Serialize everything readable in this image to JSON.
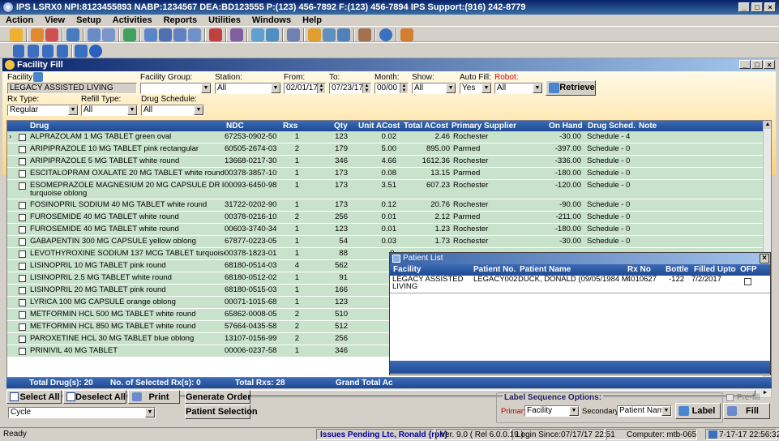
{
  "app": {
    "title": "IPS  LSRX0  NPI:8123455893  NABP:1234567  DEA:BD123555  P:(123) 456-7892  F:(123) 456-7894       IPS Support:(916) 242-8779"
  },
  "menu": [
    "Action",
    "View",
    "Setup",
    "Activities",
    "Reports",
    "Utilities",
    "Windows",
    "Help"
  ],
  "window": {
    "title": "Facility Fill"
  },
  "filters": {
    "facility_label": "Facility",
    "facility_value": "LEGACY ASSISTED LIVING",
    "facility_group_label": "Facility Group:",
    "facility_group_value": "",
    "station_label": "Station:",
    "station_value": "All",
    "from_label": "From:",
    "from_value": "02/01/17",
    "to_label": "To:",
    "to_value": "07/23/17",
    "month_label": "Month:",
    "month_value": "00/00",
    "show_label": "Show:",
    "show_value": "All",
    "autofill_label": "Auto Fill:",
    "autofill_value": "Yes",
    "robot_label": "Robot:",
    "robot_value": "All",
    "retrieve_label": "Retrieve",
    "rxtype_label": "Rx Type:",
    "rxtype_value": "Regular",
    "refilltype_label": "Refill Type:",
    "refilltype_value": "All",
    "drugschedule_label": "Drug Schedule:",
    "drugschedule_value": "All"
  },
  "grid": {
    "columns": [
      "Drug",
      "NDC",
      "Rxs",
      "Qty",
      "Unit ACost",
      "Total ACost",
      "Primary Supplier",
      "On Hand",
      "Drug Sched.",
      "Note"
    ],
    "rows": [
      {
        "drug": "ALPRAZOLAM 1 MG TABLET green oval",
        "ndc": "67253-0902-50",
        "rxs": "1",
        "qty": "123",
        "unit": "0.02",
        "total": "2.46",
        "supplier": "Rochester",
        "onhand": "-30.00",
        "sched": "Schedule - 4"
      },
      {
        "drug": "ARIPIPRAZOLE 10 MG TABLET pink rectangular",
        "ndc": "60505-2674-03",
        "rxs": "2",
        "qty": "179",
        "unit": "5.00",
        "total": "895.00",
        "supplier": "Parmed",
        "onhand": "-397.00",
        "sched": "Schedule - 0"
      },
      {
        "drug": "ARIPIPRAZOLE 5 MG TABLET white round",
        "ndc": "13668-0217-30",
        "rxs": "1",
        "qty": "346",
        "unit": "4.66",
        "total": "1612.36",
        "supplier": "Rochester",
        "onhand": "-336.00",
        "sched": "Schedule - 0"
      },
      {
        "drug": "ESCITALOPRAM OXALATE 20 MG TABLET white round",
        "ndc": "00378-3857-10",
        "rxs": "1",
        "qty": "173",
        "unit": "0.08",
        "total": "13.15",
        "supplier": "Parmed",
        "onhand": "-180.00",
        "sched": "Schedule - 0"
      },
      {
        "drug": "ESOMEPRAZOLE MAGNESIUM 20 MG CAPSULE DR light",
        "drug2": "turquoise oblong",
        "ndc": "00093-6450-98",
        "rxs": "1",
        "qty": "173",
        "unit": "3.51",
        "total": "607.23",
        "supplier": "Rochester",
        "onhand": "-120.00",
        "sched": "Schedule - 0"
      },
      {
        "drug": "FOSINOPRIL SODIUM 40 MG TABLET white round",
        "ndc": "31722-0202-90",
        "rxs": "1",
        "qty": "173",
        "unit": "0.12",
        "total": "20.76",
        "supplier": "Rochester",
        "onhand": "-90.00",
        "sched": "Schedule - 0"
      },
      {
        "drug": "FUROSEMIDE 40 MG TABLET white round",
        "ndc": "00378-0216-10",
        "rxs": "2",
        "qty": "256",
        "unit": "0.01",
        "total": "2.12",
        "supplier": "Parmed",
        "onhand": "-211.00",
        "sched": "Schedule - 0"
      },
      {
        "drug": "FUROSEMIDE 40 MG TABLET white round",
        "ndc": "00603-3740-34",
        "rxs": "1",
        "qty": "123",
        "unit": "0.01",
        "total": "1.23",
        "supplier": "Rochester",
        "onhand": "-180.00",
        "sched": "Schedule - 0"
      },
      {
        "drug": "GABAPENTIN 300 MG CAPSULE yellow oblong",
        "ndc": "67877-0223-05",
        "rxs": "1",
        "qty": "54",
        "unit": "0.03",
        "total": "1.73",
        "supplier": "Rochester",
        "onhand": "-30.00",
        "sched": "Schedule - 0"
      },
      {
        "drug": "LEVOTHYROXINE SODIUM 137 MCG TABLET turquoise oblong",
        "ndc": "00378-1823-01",
        "rxs": "1",
        "qty": "88",
        "unit": "0.",
        "total": "",
        "supplier": "",
        "onhand": "",
        "sched": ""
      },
      {
        "drug": "LISINOPRIL 10 MG TABLET pink round",
        "ndc": "68180-0514-03",
        "rxs": "4",
        "qty": "562",
        "unit": "0.",
        "total": "",
        "supplier": "",
        "onhand": "",
        "sched": ""
      },
      {
        "drug": "LISINOPRIL 2.5 MG TABLET white round",
        "ndc": "68180-0512-02",
        "rxs": "1",
        "qty": "91",
        "unit": "0.",
        "total": "",
        "supplier": "",
        "onhand": "",
        "sched": ""
      },
      {
        "drug": "LISINOPRIL 20 MG TABLET pink round",
        "ndc": "68180-0515-03",
        "rxs": "1",
        "qty": "166",
        "unit": "0.",
        "total": "",
        "supplier": "",
        "onhand": "",
        "sched": ""
      },
      {
        "drug": "LYRICA 100 MG CAPSULE orange oblong",
        "ndc": "00071-1015-68",
        "rxs": "1",
        "qty": "123",
        "unit": "5.",
        "total": "",
        "supplier": "",
        "onhand": "",
        "sched": ""
      },
      {
        "drug": "METFORMIN HCL 500 MG TABLET white round",
        "ndc": "65862-0008-05",
        "rxs": "2",
        "qty": "510",
        "unit": "0.",
        "total": "",
        "supplier": "",
        "onhand": "",
        "sched": ""
      },
      {
        "drug": "METFORMIN HCL 850 MG TABLET white round",
        "ndc": "57664-0435-58",
        "rxs": "2",
        "qty": "512",
        "unit": "0.",
        "total": "",
        "supplier": "",
        "onhand": "",
        "sched": ""
      },
      {
        "drug": "PAROXETINE HCL 30 MG TABLET blue oblong",
        "ndc": "13107-0156-99",
        "rxs": "2",
        "qty": "256",
        "unit": "0.",
        "total": "",
        "supplier": "",
        "onhand": "",
        "sched": ""
      },
      {
        "drug": "PRINIVIL 40 MG TABLET",
        "ndc": "00006-0237-58",
        "rxs": "1",
        "qty": "346",
        "unit": "1.",
        "total": "",
        "supplier": "",
        "onhand": "",
        "sched": ""
      }
    ],
    "footer": {
      "total_drugs": "Total Drug(s): 20",
      "selected_rxs": "No. of Selected Rx(s): 0",
      "total_rxs": "Total Rxs: 28",
      "grand_total": "Grand Total Ac"
    }
  },
  "patient_list": {
    "title": "Patient List",
    "columns": [
      "Facility",
      "Patient No.",
      "Patient Name",
      "Rx No",
      "Bottle",
      "Filled Upto",
      "OFP"
    ],
    "row": {
      "facility": "LEGACY ASSISTED",
      "facility2": "LIVING",
      "patient_no": "LEGACY002",
      "patient_name": "DUCK, DONALD  (09/05/1984 M",
      "rx_no": "4010627",
      "bottle": "-122",
      "filled_upto": "7/2/2017"
    }
  },
  "bottom": {
    "select_all": "Select All",
    "deselect_all": "Deselect All",
    "print": "Print",
    "generate_order": "Generate Order",
    "patient_selection": "Patient Selection",
    "cycle_value": "Cycle",
    "label_seq_title": "Label Sequence Options:",
    "primary_label": "Primary:",
    "primary_value": "Facility",
    "secondary_label": "Secondary:",
    "secondary_value": "Patient Name",
    "label_button": "Label",
    "prefill_label": "Pre-fill",
    "fill_button": "Fill"
  },
  "status": {
    "ready": "Ready",
    "issues": "Issues Pending Ltc, Ronald {rph}",
    "version": "Ver. 9.0 ( Rel 6.0.0.19 )",
    "login": "Login Since:07/17/17 22:51",
    "computer": "Computer: mtb-065",
    "datetime": "7-17-17 22:56:32"
  },
  "colors": {
    "row_bg": "#c9e2cb",
    "header_bg": "#2a55a0",
    "filter_bg": "#ffd27a"
  }
}
